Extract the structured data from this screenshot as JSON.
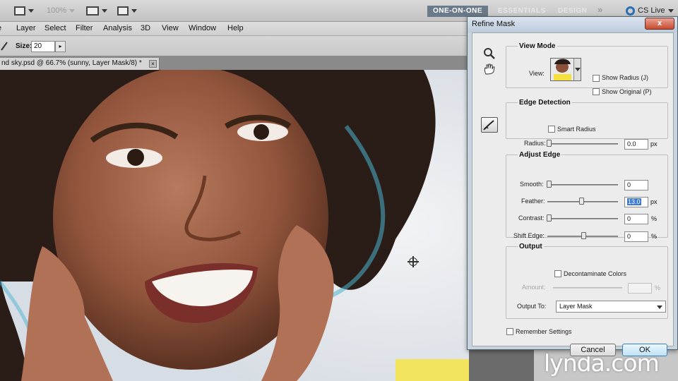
{
  "app": {
    "zoom": "100%",
    "workspaces": [
      "ONE-ON-ONE",
      "ESSENTIALS",
      "DESIGN"
    ],
    "more": "»",
    "cslive": "CS Live"
  },
  "menu": [
    "Layer",
    "Select",
    "Filter",
    "Analysis",
    "3D",
    "View",
    "Window",
    "Help"
  ],
  "options": {
    "size_label": "Size:",
    "size_value": "20"
  },
  "document_tab": {
    "title": "nd sky.psd @ 66.7% (sunny, Layer Mask/8) *",
    "close": "×"
  },
  "dialog": {
    "title": "Refine Mask",
    "close": "x",
    "view_mode": {
      "title": "View Mode",
      "view_label": "View:",
      "show_radius": "Show Radius (J)",
      "show_original": "Show Original (P)"
    },
    "edge_detection": {
      "title": "Edge Detection",
      "smart_radius": "Smart Radius",
      "radius_label": "Radius:",
      "radius_value": "0.0",
      "radius_unit": "px"
    },
    "adjust_edge": {
      "title": "Adjust Edge",
      "smooth_label": "Smooth:",
      "smooth_value": "0",
      "feather_label": "Feather:",
      "feather_value": "13.0",
      "feather_unit": "px",
      "contrast_label": "Contrast:",
      "contrast_value": "0",
      "contrast_unit": "%",
      "shift_label": "Shift Edge:",
      "shift_value": "0",
      "shift_unit": "%"
    },
    "output": {
      "title": "Output",
      "decontaminate": "Decontaminate Colors",
      "amount_label": "Amount:",
      "amount_unit": "%",
      "output_to_label": "Output To:",
      "output_to_value": "Layer Mask"
    },
    "remember": "Remember Settings",
    "cancel": "Cancel",
    "ok": "OK"
  },
  "watermark": "lynda.com"
}
